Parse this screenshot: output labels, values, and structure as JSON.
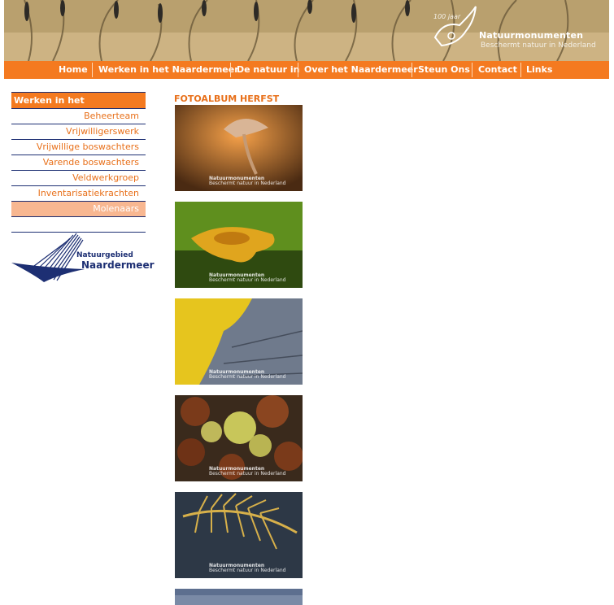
{
  "header": {
    "logo_jaar": "100 jaar",
    "logo_name": "Natuurmonumenten",
    "logo_tagline": "Beschermt natuur in Nederland"
  },
  "topnav": {
    "items": [
      {
        "label": "Home"
      },
      {
        "label": "Werken in het Naardermeer"
      },
      {
        "label": "De natuur in"
      },
      {
        "label": "Over het Naardermeer"
      },
      {
        "label": "Steun Ons"
      },
      {
        "label": "Contact"
      },
      {
        "label": "Links"
      }
    ]
  },
  "sidebar": {
    "heading": "Werken in het Naardermeer",
    "items": [
      {
        "label": "Beheerteam"
      },
      {
        "label": "Vrijwilligerswerk"
      },
      {
        "label": "Vrijwillige boswachters"
      },
      {
        "label": "Varende boswachters"
      },
      {
        "label": "Veldwerkgroep"
      },
      {
        "label": "Inventarisatiekrachten"
      },
      {
        "label": "Molenaars"
      }
    ],
    "logo_small": "Natuurgebied",
    "logo_big": "Naardermeer"
  },
  "content": {
    "title": "FOTOALBUM HERFST",
    "watermark_name": "Natuurmonumenten",
    "watermark_tag": "Beschermt natuur in Nederland",
    "photos": [
      {
        "subject": "mushroom-photo"
      },
      {
        "subject": "chanterelle-photo"
      },
      {
        "subject": "lichen-photo"
      },
      {
        "subject": "chestnuts-photo"
      },
      {
        "subject": "fern-photo"
      },
      {
        "subject": "water-photo"
      }
    ]
  },
  "colors": {
    "accent_orange": "#f47a20",
    "link_orange": "#e8701a",
    "active_item": "#f8b791",
    "navy": "#1d2f73"
  }
}
